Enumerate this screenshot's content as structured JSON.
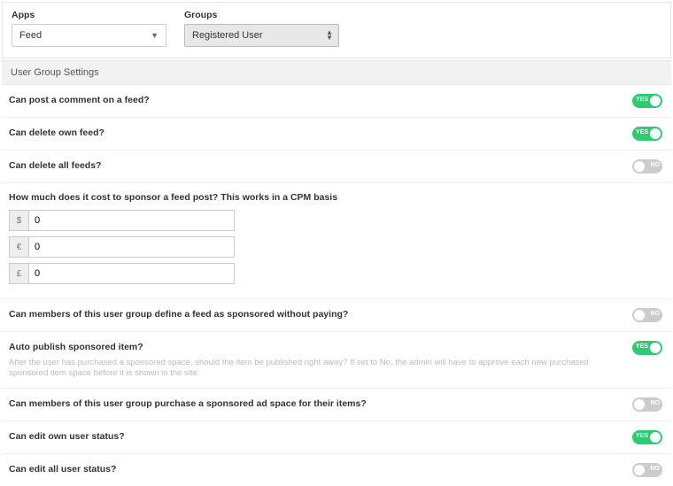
{
  "filters": {
    "apps_label": "Apps",
    "apps_value": "Feed",
    "groups_label": "Groups",
    "groups_value": "Registered User"
  },
  "section_title": "User Group Settings",
  "toggle_yes": "YES",
  "toggle_no": "NO",
  "settings": {
    "post_comment": {
      "label": "Can post a comment on a feed?",
      "value": true
    },
    "delete_own": {
      "label": "Can delete own feed?",
      "value": true
    },
    "delete_all": {
      "label": "Can delete all feeds?",
      "value": false
    },
    "cost_sponsor": {
      "label": "How much does it cost to sponsor a feed post? This works in a CPM basis",
      "currencies": [
        {
          "symbol": "$",
          "value": "0"
        },
        {
          "symbol": "€",
          "value": "0"
        },
        {
          "symbol": "£",
          "value": "0"
        }
      ]
    },
    "define_sponsored": {
      "label": "Can members of this user group define a feed as sponsored without paying?",
      "value": false
    },
    "auto_publish": {
      "label": "Auto publish sponsored item?",
      "help": "After the user has purchased a sponsored space, should the item be published right away? If set to No, the admin will have to approve each new purchased sponsored item space before it is shown in the site.",
      "value": true
    },
    "purchase_ad": {
      "label": "Can members of this user group purchase a sponsored ad space for their items?",
      "value": false
    },
    "edit_own_status": {
      "label": "Can edit own user status?",
      "value": true
    },
    "edit_all_status": {
      "label": "Can edit all user status?",
      "value": false
    }
  }
}
